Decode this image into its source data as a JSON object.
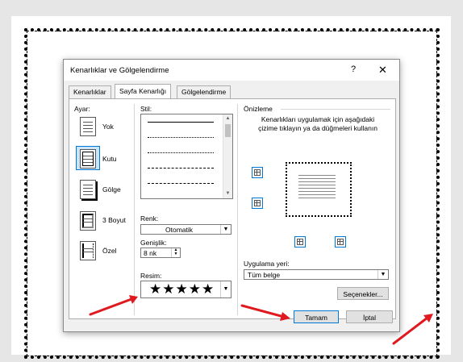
{
  "dialog": {
    "title": "Kenarlıklar ve Gölgelendirme",
    "help": "?",
    "close": "✕"
  },
  "tabs": [
    {
      "label": "Kenarlıklar"
    },
    {
      "label": "Sayfa Kenarlığı"
    },
    {
      "label": "Gölgelendirme"
    }
  ],
  "settings": {
    "label": "Ayar:",
    "items": [
      {
        "label": "Yok"
      },
      {
        "label": "Kutu"
      },
      {
        "label": "Gölge"
      },
      {
        "label": "3 Boyut"
      },
      {
        "label": "Özel"
      }
    ]
  },
  "style": {
    "label": "Stil:"
  },
  "color": {
    "label": "Renk:",
    "value": "Otomatik"
  },
  "width": {
    "label": "Genişlik:",
    "value": "8 nk"
  },
  "art": {
    "label": "Resim:",
    "value": "★★★★★"
  },
  "preview": {
    "label": "Önizleme",
    "hint": "Kenarlıkları uygulamak için aşağıdaki çizime tıklayın ya da düğmeleri kullanın"
  },
  "apply": {
    "label": "Uygulama yeri:",
    "value": "Tüm belge"
  },
  "buttons": {
    "options": "Seçenekler...",
    "ok": "Tamam",
    "cancel": "İptal"
  },
  "colors": {
    "accent": "#0078d7",
    "arrow": "#e0191f"
  }
}
